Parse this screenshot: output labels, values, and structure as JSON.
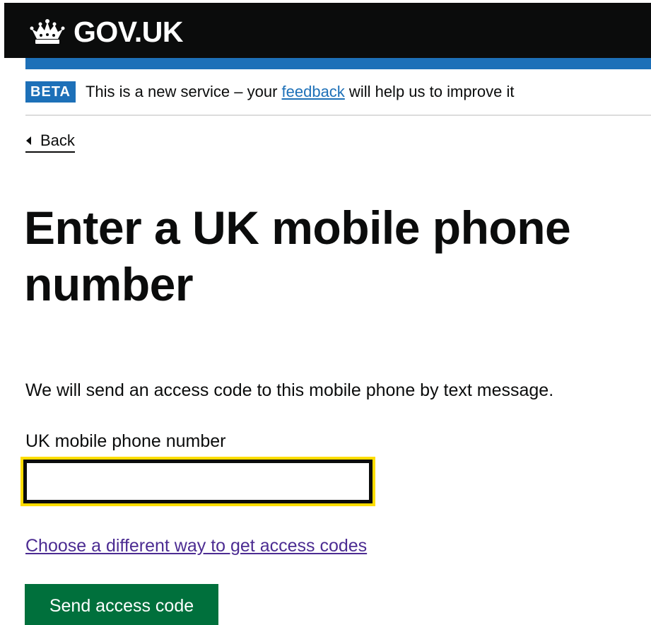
{
  "header": {
    "logo_text": "GOV.UK",
    "logo_icon": "crown-icon",
    "background_color": "#0b0c0c",
    "accent_color": "#1d70b8"
  },
  "phase_banner": {
    "tag": "BETA",
    "text_before": "This is a new service – your ",
    "link_text": "feedback",
    "text_after": " will help us to improve it"
  },
  "navigation": {
    "back_label": "Back",
    "back_icon": "chevron-left-icon"
  },
  "main": {
    "title": "Enter a UK mobile phone number",
    "hint": "We will send an access code to this mobile phone by text message.",
    "field_label": "UK mobile phone number",
    "field_value": "",
    "alternative_link": "Choose a different way to get access codes",
    "submit_label": "Send access code"
  },
  "colors": {
    "focus": "#ffdd00",
    "button": "#00703c",
    "visited_link": "#4c2c92"
  }
}
